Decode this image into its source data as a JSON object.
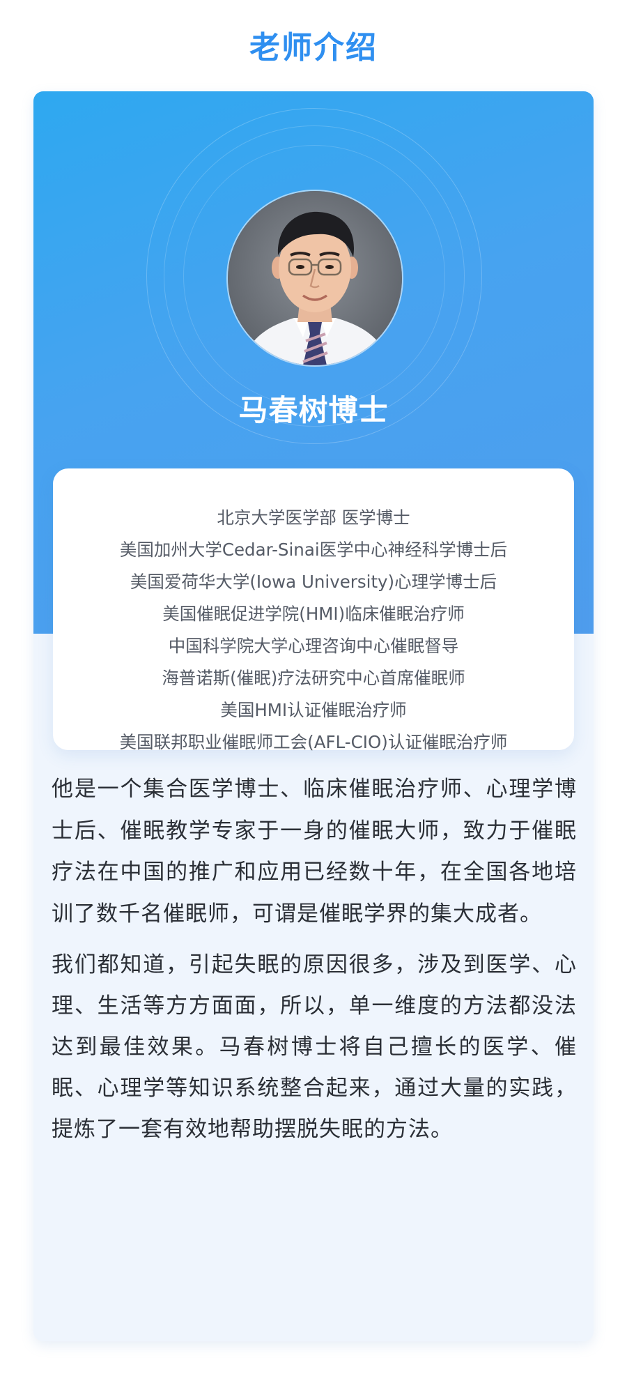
{
  "page": {
    "title": "老师介绍"
  },
  "teacher": {
    "name": "马春树博士",
    "avatar_icon": "portrait-photo",
    "credentials": [
      "北京大学医学部 医学博士",
      "美国加州大学Cedar-Sinai医学中心神经科学博士后",
      "美国爱荷华大学(Iowa University)心理学博士后",
      "美国催眠促进学院(HMI)临床催眠治疗师",
      "中国科学院大学心理咨询中心催眠督导",
      "海普诺斯(催眠)疗法研究中心首席催眠师",
      "美国HMI认证催眠治疗师",
      "美国联邦职业催眠师工会(AFL-CIO)认证催眠治疗师"
    ]
  },
  "bio": {
    "paragraph_1": "他是一个集合医学博士、临床催眠治疗师、心理学博士后、催眠教学专家于一身的催眠大师，致力于催眠疗法在中国的推广和应用已经数十年，在全国各地培训了数千名催眠师，可谓是催眠学界的集大成者。",
    "paragraph_2": "我们都知道，引起失眠的原因很多，涉及到医学、心理、生活等方方面面，所以，单一维度的方法都没法达到最佳效果。马春树博士将自己擅长的医学、催眠、心理学等知识系统整合起来，通过大量的实践，提炼了一套有效地帮助摆脱失眠的方法。"
  },
  "colors": {
    "title_blue": "#2f8ff0",
    "hero_gradient_start": "#2ea8f0",
    "hero_gradient_end": "#4f9ded",
    "card_background": "#eff5fd",
    "credential_text": "#555b66",
    "body_text": "#2b2f36"
  }
}
